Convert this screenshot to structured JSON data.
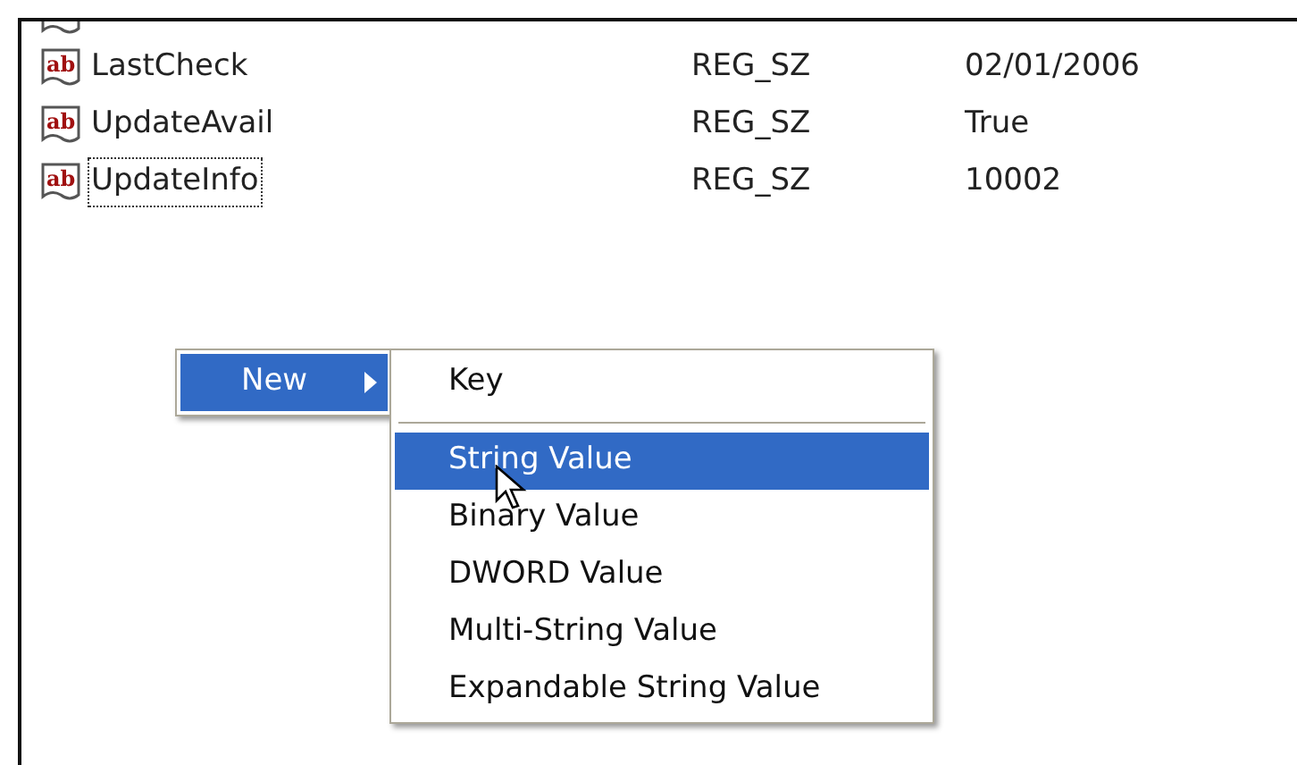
{
  "values_list": {
    "rows": [
      {
        "icon_text": "ab",
        "name": "LastCheck",
        "type": "REG_SZ",
        "data": "02/01/2006",
        "focused": false
      },
      {
        "icon_text": "ab",
        "name": "UpdateAvail",
        "type": "REG_SZ",
        "data": "True",
        "focused": false
      },
      {
        "icon_text": "ab",
        "name": "UpdateInfo",
        "type": "REG_SZ",
        "data": "10002",
        "focused": true
      }
    ]
  },
  "context_menu": {
    "items": [
      {
        "label": "New",
        "selected": true
      }
    ]
  },
  "submenu": {
    "items": [
      {
        "kind": "item",
        "label": "Key",
        "selected": false
      },
      {
        "kind": "separator"
      },
      {
        "kind": "item",
        "label": "String Value",
        "selected": true
      },
      {
        "kind": "item",
        "label": "Binary Value",
        "selected": false
      },
      {
        "kind": "item",
        "label": "DWORD Value",
        "selected": false
      },
      {
        "kind": "item",
        "label": "Multi-String Value",
        "selected": false
      },
      {
        "kind": "item",
        "label": "Expandable String Value",
        "selected": false
      }
    ]
  }
}
